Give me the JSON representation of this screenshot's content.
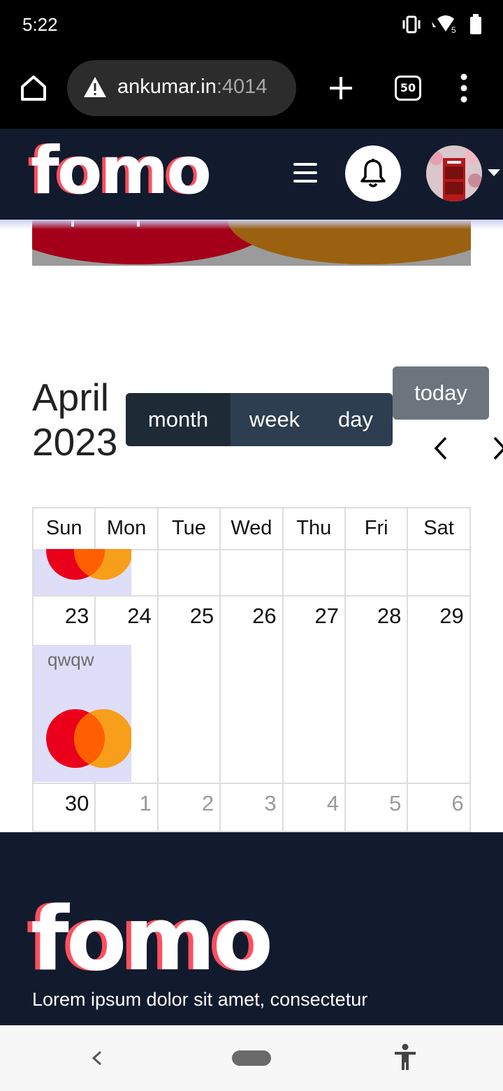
{
  "status_bar": {
    "time": "5:22",
    "battery_level": 0.9
  },
  "browser": {
    "url_host": "ankumar.in",
    "url_port": ":4014",
    "tab_count": "50",
    "icons": [
      "home-icon",
      "warning-icon",
      "plus-icon",
      "tabs-icon",
      "more-vert-icon"
    ]
  },
  "header": {
    "logo": "fomo",
    "icons": [
      "hamburger-icon",
      "bell-icon",
      "avatar",
      "caret-down-icon"
    ]
  },
  "calendar": {
    "title_line1": "April",
    "title_line2": "2023",
    "views": [
      "month",
      "week",
      "day"
    ],
    "active_view": "month",
    "today_label": "today",
    "weekdays": [
      "Sun",
      "Mon",
      "Tue",
      "Wed",
      "Thu",
      "Fri",
      "Sat"
    ],
    "weeks": [
      {
        "days": [
          "",
          "",
          "",
          "",
          "",
          "",
          ""
        ]
      },
      {
        "days": [
          "23",
          "24",
          "25",
          "26",
          "27",
          "28",
          "29"
        ]
      },
      {
        "days": [
          "30",
          "1",
          "2",
          "3",
          "4",
          "5",
          "6"
        ]
      }
    ],
    "event": {
      "title": "qwqw"
    },
    "colors": {
      "event_bg": "#dedef8",
      "toolbar_bg": "#2c3e50",
      "today_bg": "#6c757d"
    }
  },
  "footer": {
    "logo": "fomo",
    "text": "Lorem ipsum dolor sit amet, consectetur"
  },
  "colors": {
    "navy": "#121a2e",
    "logo_accent": "#ff4f5f"
  }
}
